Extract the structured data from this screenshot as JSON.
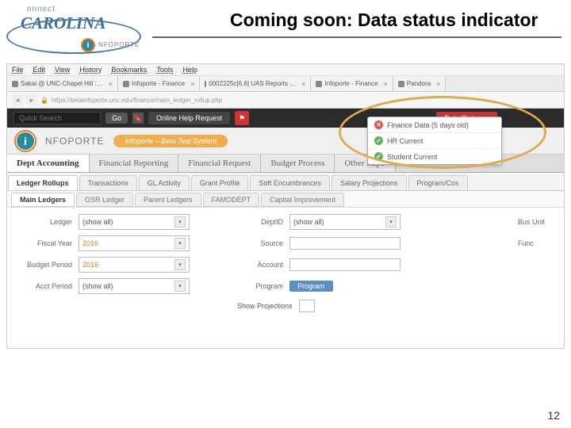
{
  "slide": {
    "title": "Coming soon:  Data status indicator",
    "page_number": "12"
  },
  "branding": {
    "connect": "onnect",
    "carolina": "CAROLINA",
    "infoporte": "NFOPORTE",
    "i": "i"
  },
  "browser_menu": [
    "File",
    "Edit",
    "View",
    "History",
    "Bookmarks",
    "Tools",
    "Help"
  ],
  "tabs": [
    {
      "label": "Sakai @ UNC-Chapel Hill :…"
    },
    {
      "label": "Infoporte - Finance"
    },
    {
      "label": "0002225c[6.6] UAS Reports …"
    },
    {
      "label": "Infoporte - Finance"
    },
    {
      "label": "Pandora"
    }
  ],
  "address": {
    "url": "https://betainfoporte.unc.edu/finance/main_ledger_rollup.php"
  },
  "topbar": {
    "search_placeholder": "Quick Search",
    "go": "Go",
    "help": "Online Help Request",
    "data_status": "Data Status"
  },
  "status_items": [
    {
      "class": "red-dot",
      "glyph": "✕",
      "label": "Finance Data (5 days old)"
    },
    {
      "class": "green-dot",
      "glyph": "✓",
      "label": "HR Current"
    },
    {
      "class": "green-dot",
      "glyph": "✓",
      "label": "Student Current"
    }
  ],
  "app_header": {
    "name": "NFOPORTE",
    "beta": "Infoporte – Beta Test System"
  },
  "nav_tabs": [
    "Dept Accounting",
    "Financial Reporting",
    "Financial Request",
    "Budget Process",
    "Other Repo"
  ],
  "sub_tabs": [
    "Ledger Rollups",
    "Transactions",
    "GL Activity",
    "Grant Profile",
    "Soft Encumbrances",
    "Salary Projections",
    "Program/Cos"
  ],
  "sub_tabs2": [
    "Main Ledgers",
    "OSR Ledger",
    "Parent Ledgers",
    "FAMODEPT",
    "Capital Improvement"
  ],
  "filters": {
    "ledger_label": "Ledger",
    "ledger_value": "(show all)",
    "deptid_label": "DeptID",
    "deptid_value": "(show all)",
    "busunit_label": "Bus Unit",
    "fy_label": "Fiscal Year",
    "fy_value": "2016",
    "source_label": "Source",
    "func_label": "Func",
    "bp_label": "Budget Period",
    "bp_value": "2016",
    "account_label": "Account",
    "ap_label": "Acct Period",
    "ap_value": "(show all)",
    "program_label": "Program",
    "program_btn": "Program",
    "showproj_label": "Show Projections"
  }
}
